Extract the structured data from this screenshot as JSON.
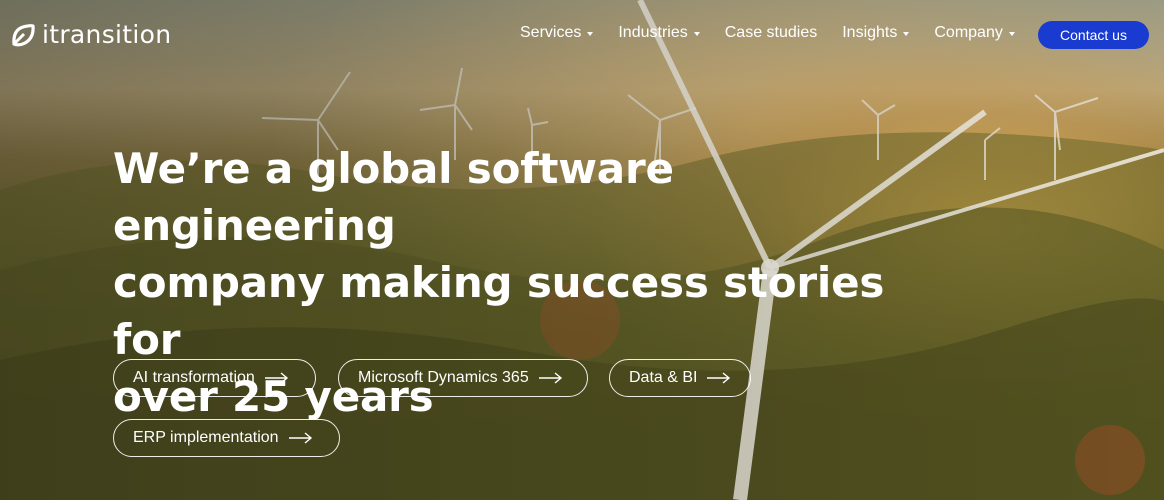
{
  "brand": {
    "name": "itransition"
  },
  "nav": {
    "items": [
      {
        "label": "Services",
        "has_dropdown": true
      },
      {
        "label": "Industries",
        "has_dropdown": true
      },
      {
        "label": "Case studies",
        "has_dropdown": false
      },
      {
        "label": "Insights",
        "has_dropdown": true
      },
      {
        "label": "Company",
        "has_dropdown": true
      }
    ],
    "cta_label": "Contact us"
  },
  "hero": {
    "headline_lines": [
      "We’re a global software engineering",
      "company making success stories for",
      "over 25 years"
    ],
    "buttons": [
      "AI transformation",
      "Microsoft Dynamics 365",
      "Data & BI",
      "ERP implementation"
    ]
  },
  "colors": {
    "cta": "#1a3bd0",
    "text": "#ffffff"
  }
}
